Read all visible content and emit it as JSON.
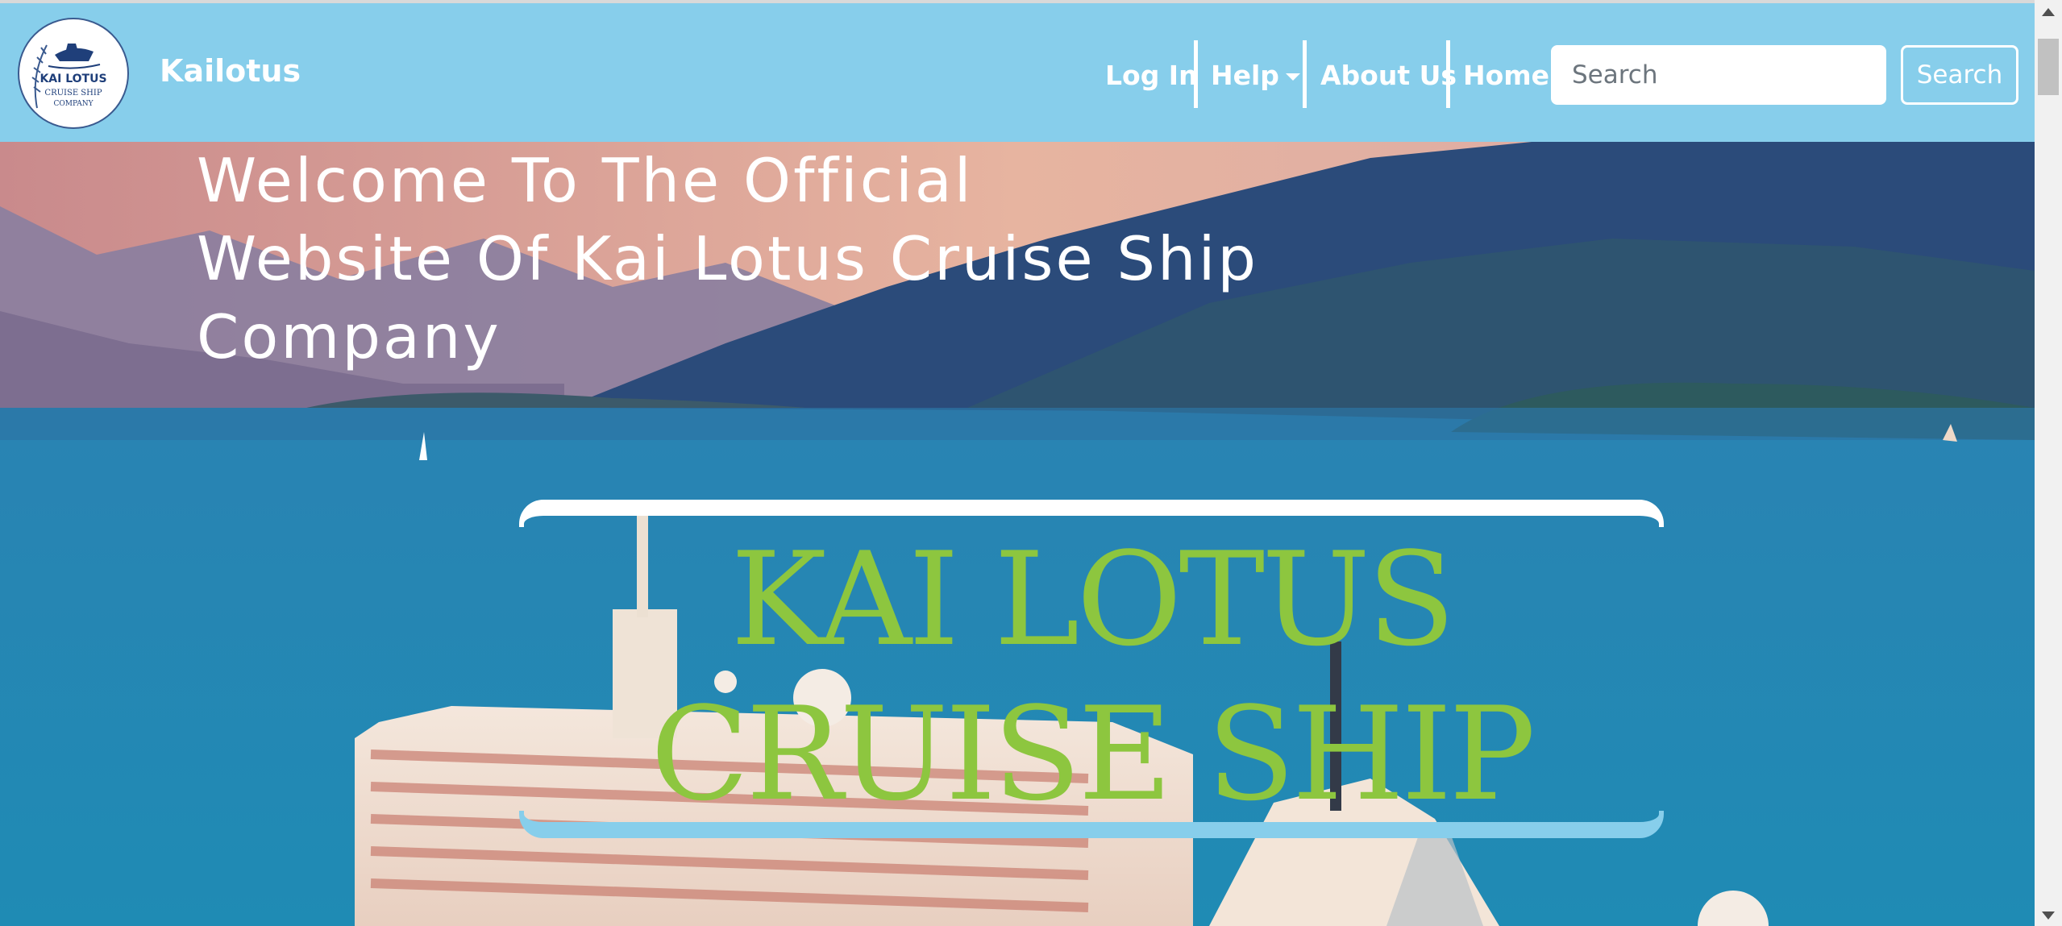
{
  "brand": {
    "logo_lines": [
      "KAI LOTUS",
      "CRUISE SHIP",
      "COMPANY"
    ],
    "name": "Kailotus"
  },
  "nav": {
    "items": [
      {
        "label": "Log In"
      },
      {
        "label": "Help"
      },
      {
        "label": "About Us"
      },
      {
        "label": "Home"
      }
    ],
    "search_placeholder": "Search",
    "search_button": "Search"
  },
  "hero": {
    "welcome_lines": [
      "Welcome To The Official",
      "Website Of Kai Lotus Cruise Ship",
      "Company"
    ],
    "banner_lines": [
      "KAI LOTUS",
      "CRUISE SHIP"
    ]
  },
  "colors": {
    "navbar": "#87ceeb",
    "banner_text": "#8dc63f",
    "text_light": "#ffffff"
  },
  "icons": {
    "help_dropdown": "caret-down-icon",
    "scroll_up": "scroll-up-arrow",
    "scroll_down": "scroll-down-arrow"
  }
}
